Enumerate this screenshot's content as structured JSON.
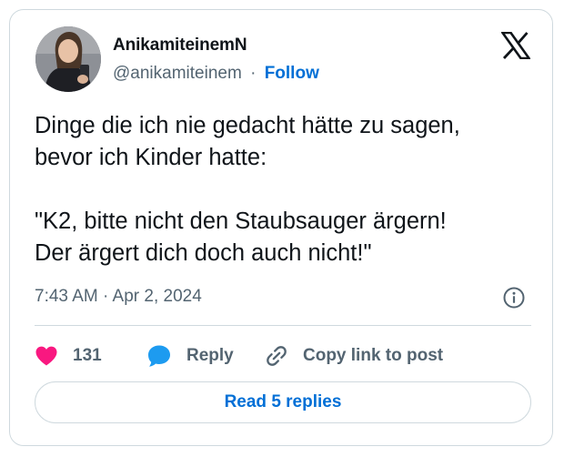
{
  "author": {
    "display_name": "AnikamiteinemN",
    "handle": "@anikamiteinem",
    "separator": "·",
    "follow_label": "Follow"
  },
  "tweet": {
    "text": "Dinge die ich nie gedacht hätte zu sagen,\nbevor ich Kinder hatte:\n\n\"K2, bitte nicht den Staubsauger ärgern!\nDer ärgert dich doch auch nicht!\"",
    "timestamp": "7:43 AM · Apr 2, 2024"
  },
  "actions": {
    "like_count": "131",
    "reply_label": "Reply",
    "copy_link_label": "Copy link to post"
  },
  "footer": {
    "read_replies_label": "Read 5 replies"
  },
  "icons": {
    "brand": "x-logo-icon",
    "info": "info-icon",
    "like": "heart-icon",
    "reply": "speech-bubble-icon",
    "copy": "link-icon"
  },
  "colors": {
    "like_pink": "#f91880",
    "reply_blue": "#1d9bf0",
    "link_blue": "#006fd6",
    "text_primary": "#0f1419",
    "text_secondary": "#536471",
    "border": "#cfd9de"
  }
}
